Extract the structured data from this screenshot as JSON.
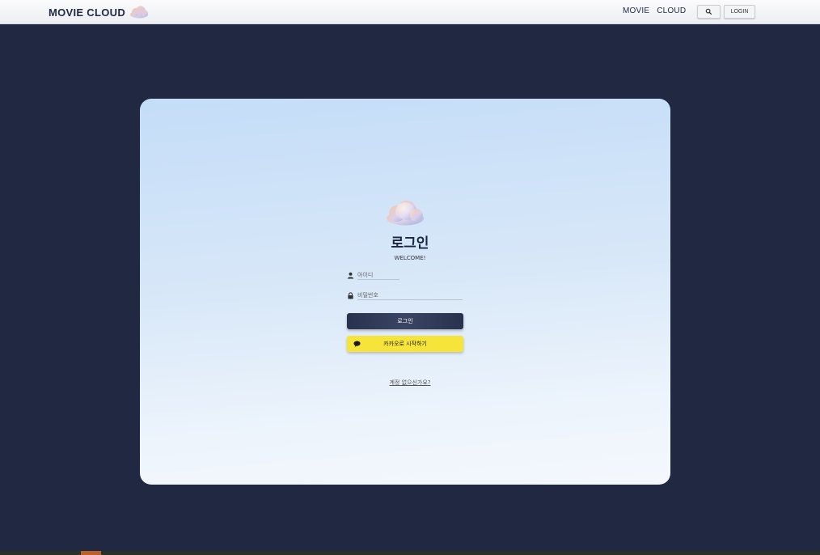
{
  "header": {
    "brand": "MOVIE CLOUD",
    "nav": [
      "MOVIE",
      "CLOUD"
    ],
    "login_label": "LOGIN",
    "search_icon": "search-icon"
  },
  "login": {
    "title": "로그인",
    "subtitle": "WELCOME!",
    "id_placeholder": "아이디",
    "pw_placeholder": "비밀번호",
    "submit_label": "로그인",
    "kakao_label": "카카오로 시작하기",
    "forgot_label": "계정 없으신가요?"
  },
  "colors": {
    "background": "#202842",
    "kakao": "#f7e43a",
    "primary_button": "#2c3652"
  }
}
